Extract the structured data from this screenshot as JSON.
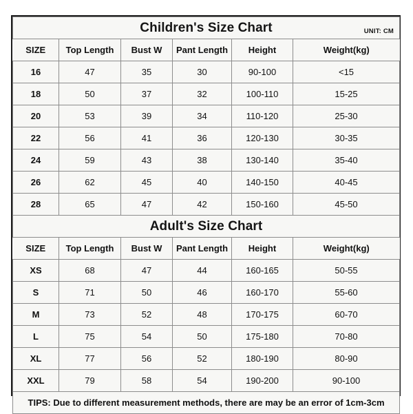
{
  "document": {
    "unit_label": "UNIT: CM",
    "tips": "TIPS: Due to different measurement methods, there are may be an error of 1cm-3cm",
    "accent_color": "#11a9e6",
    "tips_color": "#e0202a",
    "cell_color": "#f7f7f5",
    "border_color": "#8c8c8c"
  },
  "children_table": {
    "title": "Children's Size Chart",
    "columns": [
      "SIZE",
      "Top Length",
      "Bust W",
      "Pant Length",
      "Height",
      "Weight(kg)"
    ],
    "rows": [
      [
        "16",
        "47",
        "35",
        "30",
        "90-100",
        "<15"
      ],
      [
        "18",
        "50",
        "37",
        "32",
        "100-110",
        "15-25"
      ],
      [
        "20",
        "53",
        "39",
        "34",
        "110-120",
        "25-30"
      ],
      [
        "22",
        "56",
        "41",
        "36",
        "120-130",
        "30-35"
      ],
      [
        "24",
        "59",
        "43",
        "38",
        "130-140",
        "35-40"
      ],
      [
        "26",
        "62",
        "45",
        "40",
        "140-150",
        "40-45"
      ],
      [
        "28",
        "65",
        "47",
        "42",
        "150-160",
        "45-50"
      ]
    ]
  },
  "adult_table": {
    "title": "Adult's Size Chart",
    "columns": [
      "SIZE",
      "Top Length",
      "Bust W",
      "Pant Length",
      "Height",
      "Weight(kg)"
    ],
    "rows": [
      [
        "XS",
        "68",
        "47",
        "44",
        "160-165",
        "50-55"
      ],
      [
        "S",
        "71",
        "50",
        "46",
        "160-170",
        "55-60"
      ],
      [
        "M",
        "73",
        "52",
        "48",
        "170-175",
        "60-70"
      ],
      [
        "L",
        "75",
        "54",
        "50",
        "175-180",
        "70-80"
      ],
      [
        "XL",
        "77",
        "56",
        "52",
        "180-190",
        "80-90"
      ],
      [
        "XXL",
        "79",
        "58",
        "54",
        "190-200",
        "90-100"
      ]
    ]
  },
  "chart_data": {
    "type": "table",
    "title": "Children's and Adult's Size Chart",
    "tables": [
      {
        "name": "Children's Size Chart",
        "unit": "CM",
        "columns": [
          "SIZE",
          "Top Length",
          "Bust W",
          "Pant Length",
          "Height",
          "Weight(kg)"
        ],
        "rows": [
          [
            "16",
            "47",
            "35",
            "30",
            "90-100",
            "<15"
          ],
          [
            "18",
            "50",
            "37",
            "32",
            "100-110",
            "15-25"
          ],
          [
            "20",
            "53",
            "39",
            "34",
            "110-120",
            "25-30"
          ],
          [
            "22",
            "56",
            "41",
            "36",
            "120-130",
            "30-35"
          ],
          [
            "24",
            "59",
            "43",
            "38",
            "130-140",
            "35-40"
          ],
          [
            "26",
            "62",
            "45",
            "40",
            "140-150",
            "40-45"
          ],
          [
            "28",
            "65",
            "47",
            "42",
            "150-160",
            "45-50"
          ]
        ]
      },
      {
        "name": "Adult's Size Chart",
        "unit": "CM",
        "columns": [
          "SIZE",
          "Top Length",
          "Bust W",
          "Pant Length",
          "Height",
          "Weight(kg)"
        ],
        "rows": [
          [
            "XS",
            "68",
            "47",
            "44",
            "160-165",
            "50-55"
          ],
          [
            "S",
            "71",
            "50",
            "46",
            "160-170",
            "55-60"
          ],
          [
            "M",
            "73",
            "52",
            "48",
            "170-175",
            "60-70"
          ],
          [
            "L",
            "75",
            "54",
            "50",
            "175-180",
            "70-80"
          ],
          [
            "XL",
            "77",
            "56",
            "52",
            "180-190",
            "80-90"
          ],
          [
            "XXL",
            "79",
            "58",
            "54",
            "190-200",
            "90-100"
          ]
        ]
      }
    ],
    "note": "TIPS: Due to different measurement methods, there are may be an error of 1cm-3cm"
  }
}
